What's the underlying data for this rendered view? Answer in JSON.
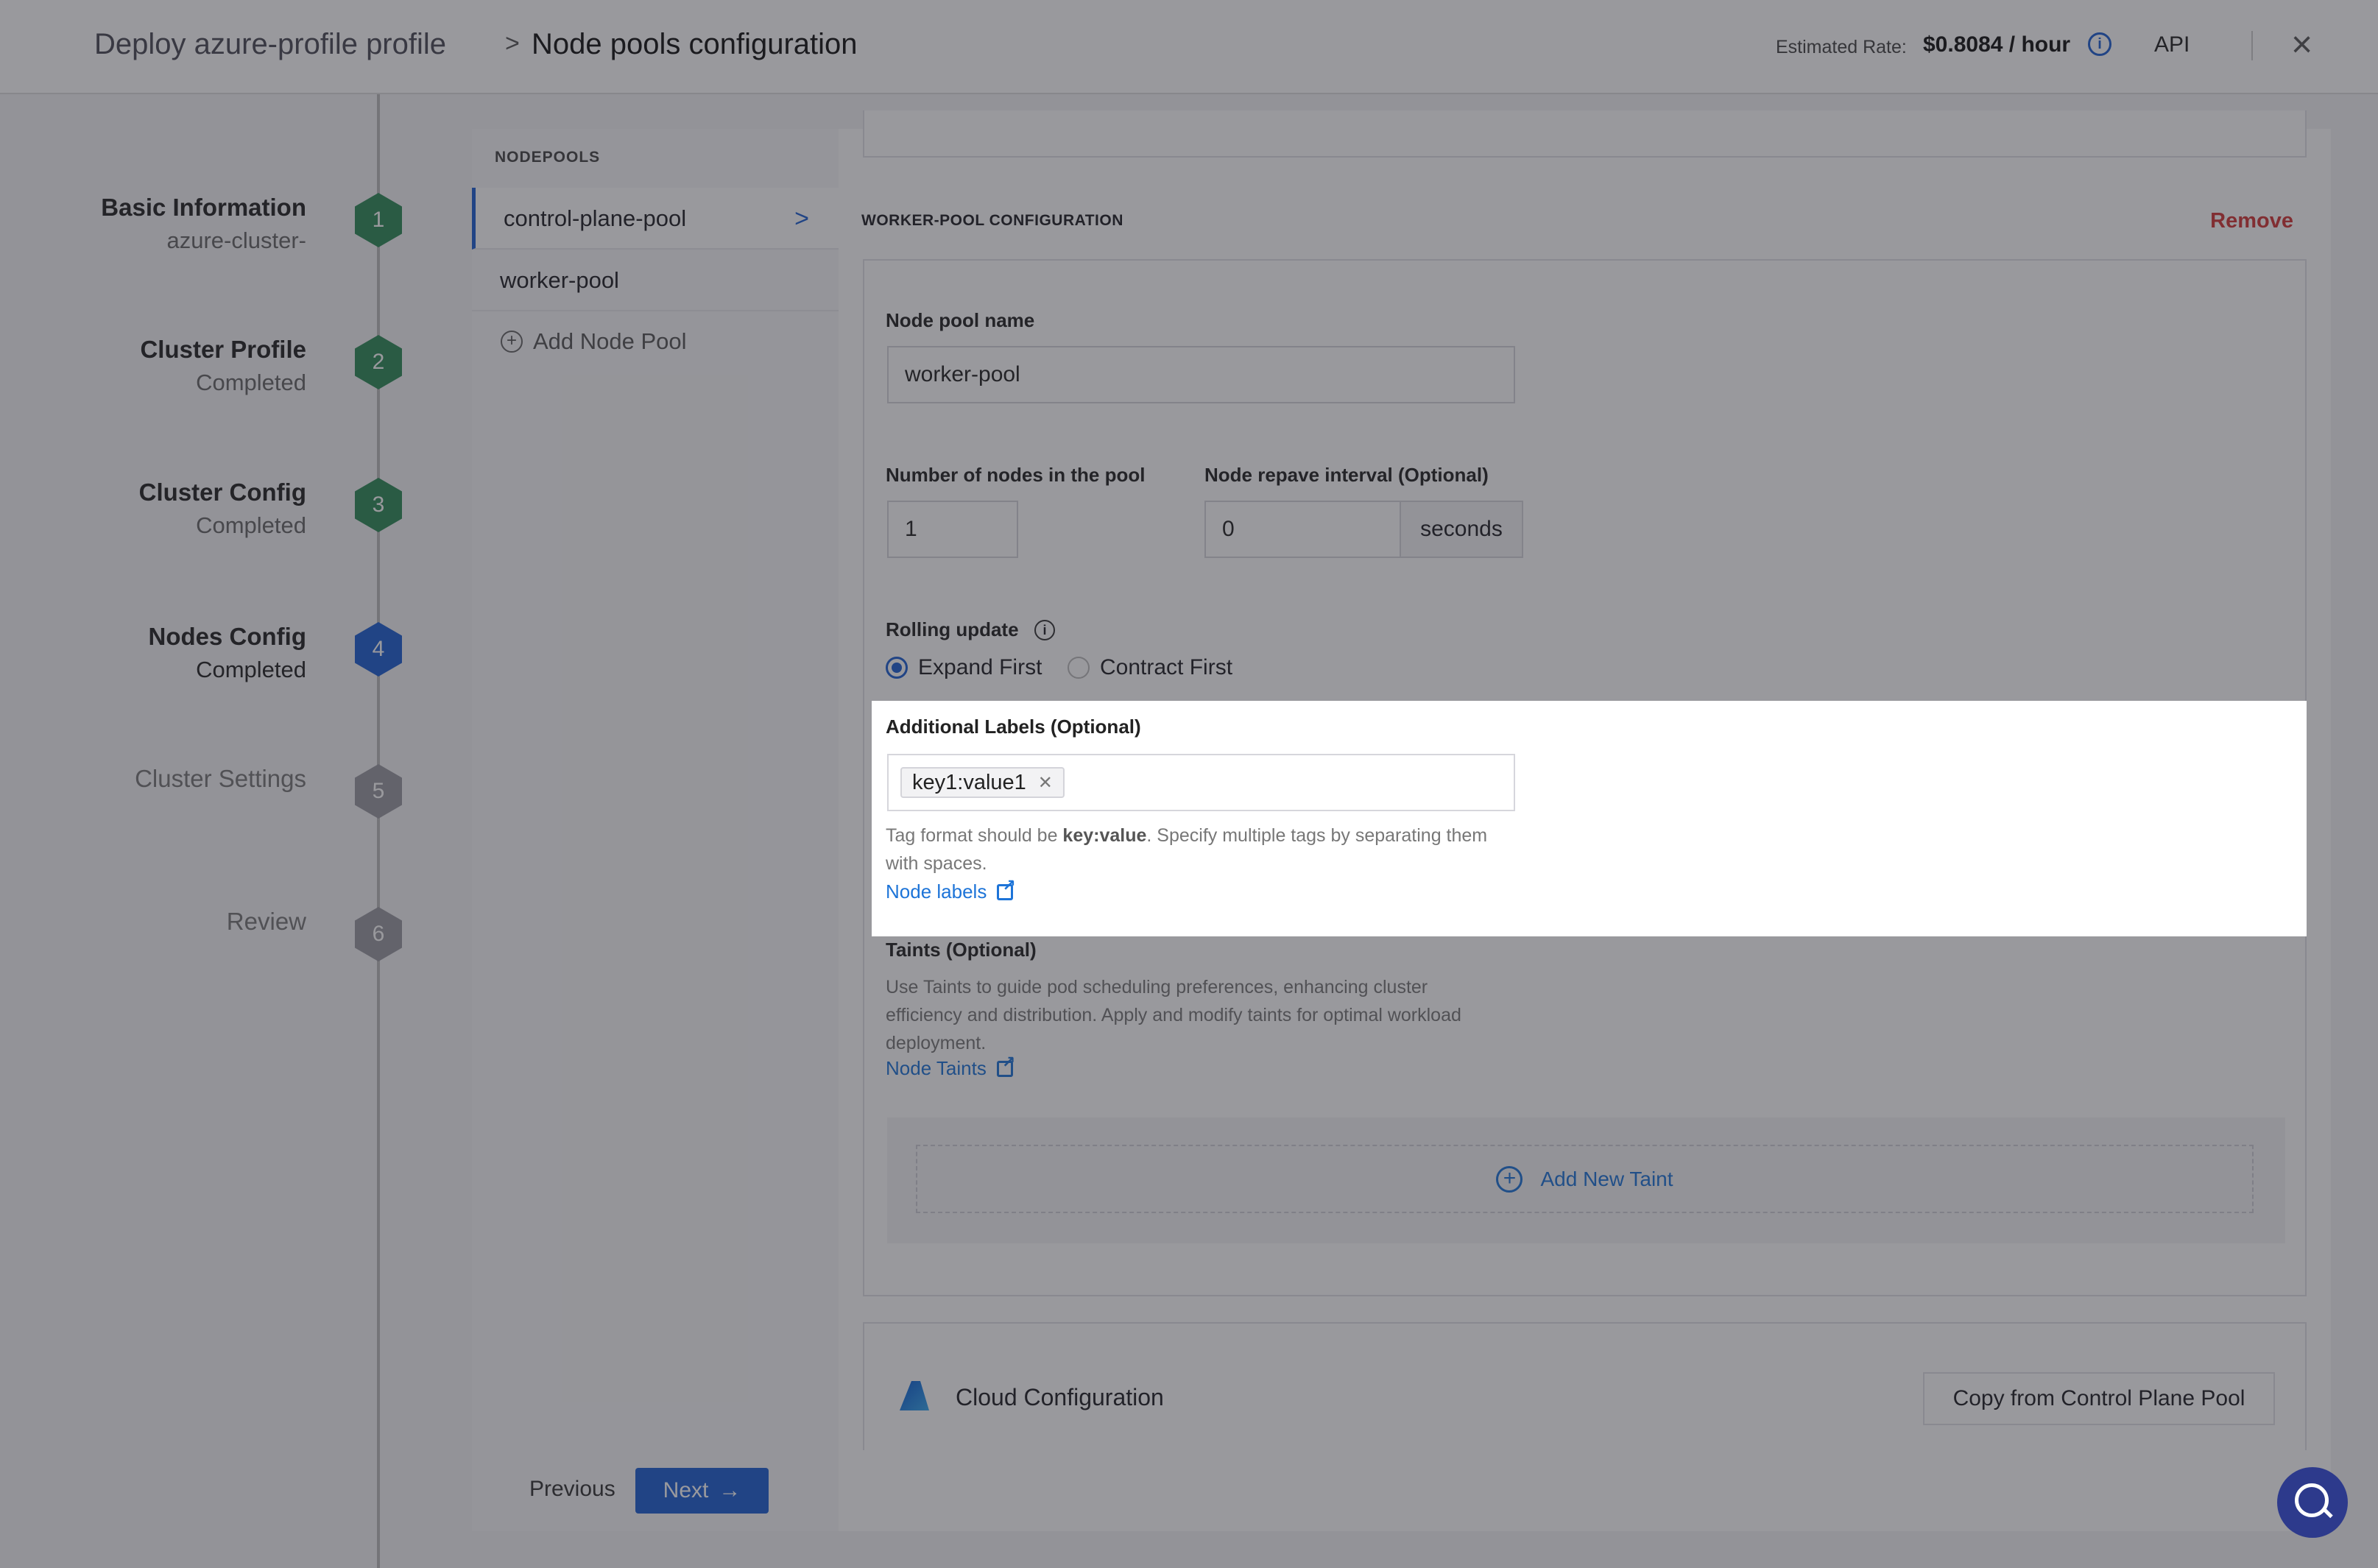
{
  "header": {
    "breadcrumb_parent": "Deploy azure-profile profile",
    "breadcrumb_sep": ">",
    "breadcrumb_current": "Node pools configuration",
    "rate_label": "Estimated Rate:",
    "rate_value": "$0.8084 / hour",
    "info_icon": "i",
    "api_label": "API",
    "close_icon": "×"
  },
  "steps": [
    {
      "title": "Basic Information",
      "subtitle": "azure-cluster-",
      "num": "1",
      "state": "done"
    },
    {
      "title": "Cluster Profile",
      "subtitle": "Completed",
      "num": "2",
      "state": "done"
    },
    {
      "title": "Cluster Config",
      "subtitle": "Completed",
      "num": "3",
      "state": "done"
    },
    {
      "title": "Nodes Config",
      "subtitle": "Completed",
      "num": "4",
      "state": "active"
    },
    {
      "title": "Cluster Settings",
      "subtitle": "",
      "num": "5",
      "state": "pending"
    },
    {
      "title": "Review",
      "subtitle": "",
      "num": "6",
      "state": "pending"
    }
  ],
  "colors": {
    "done": "#2e8b57",
    "active": "#1d5fd1",
    "pending": "#9a9aa0",
    "accent": "#1d5fd1",
    "danger": "#d23535"
  },
  "nodepools": {
    "heading": "NODEPOOLS",
    "items": [
      "control-plane-pool",
      "worker-pool"
    ],
    "chevron": ">",
    "add_label": "Add Node Pool"
  },
  "config": {
    "section_title": "WORKER-POOL CONFIGURATION",
    "remove_label": "Remove",
    "name_label": "Node pool name",
    "name_value": "worker-pool",
    "count_label": "Number of nodes in the pool",
    "count_value": "1",
    "repave_label": "Node repave interval (Optional)",
    "repave_value": "0",
    "repave_unit": "seconds",
    "rolling_label": "Rolling update",
    "rolling_options": [
      "Expand First",
      "Contract First"
    ],
    "rolling_selected": "Expand First",
    "labels_label": "Additional Labels (Optional)",
    "labels_tags": [
      "key1:value1"
    ],
    "labels_help_pre": "Tag format should be ",
    "labels_help_bold": "key:value",
    "labels_help_post": ". Specify multiple tags by separating them with spaces.",
    "labels_link": "Node labels",
    "taints_label": "Taints (Optional)",
    "taints_help": "Use Taints to guide pod scheduling preferences, enhancing cluster efficiency and distribution. Apply and modify taints for optimal workload deployment.",
    "taints_link": "Node Taints",
    "add_taint": "Add New Taint"
  },
  "cloud": {
    "title": "Cloud Configuration",
    "copy_button": "Copy from Control Plane Pool"
  },
  "footer": {
    "previous": "Previous",
    "next": "Next"
  }
}
